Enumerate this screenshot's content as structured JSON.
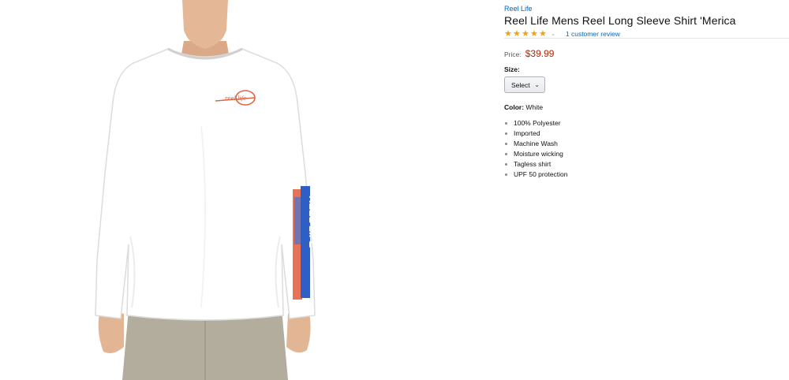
{
  "product": {
    "brand": "Reel Life",
    "title": "Reel Life Mens Reel Long Sleeve Shirt 'Merica",
    "rating_value": 5,
    "rating_max": 5,
    "review_link_text": "1 customer review",
    "price_label": "Price:",
    "price_value": "$39.99",
    "size_label": "Size:",
    "size_select_value": "Select",
    "color_label": "Color:",
    "color_value": "White",
    "features": [
      "100% Polyester",
      "Imported",
      "Machine Wash",
      "Moisture wicking",
      "Tagless shirt",
      "UPF 50 protection"
    ]
  },
  "image": {
    "chest_logo_text": "reel life",
    "sleeve_print_text": "REEL LIFE",
    "colors": {
      "shirt": "#ffffff",
      "skin": "#e2b595",
      "shorts": "#b2ad9d",
      "logo_orange": "#e0643e",
      "sleeve_blue": "#2f5fc4"
    }
  },
  "theme": {
    "link": "#0066c0",
    "price": "#b12704",
    "star": "#f0a30a"
  }
}
